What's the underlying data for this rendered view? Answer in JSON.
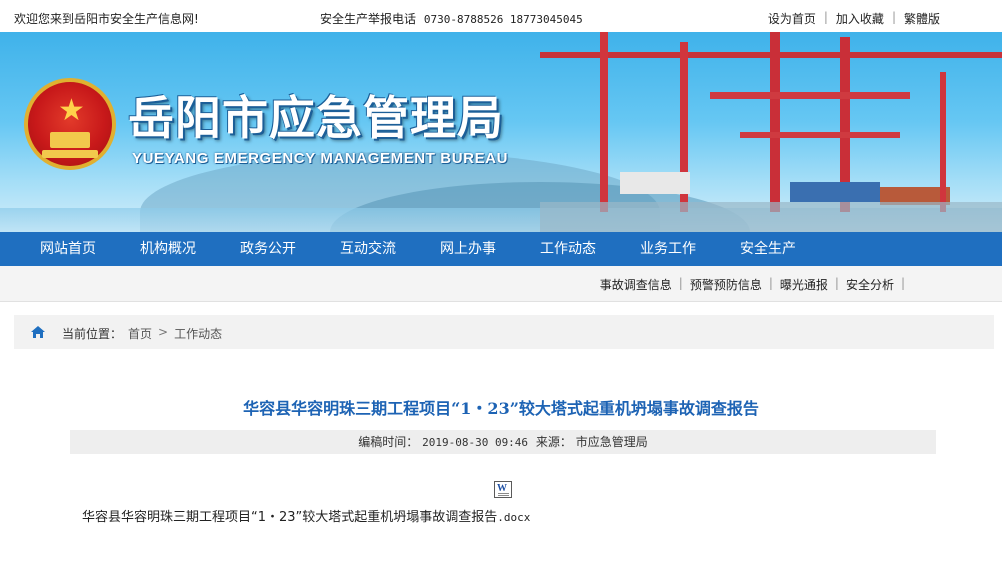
{
  "topbar": {
    "welcome": "欢迎您来到岳阳市安全生产信息网!",
    "hotline_label": "安全生产举报电话",
    "hotline_numbers": "0730-8788526 18773045045",
    "links": [
      "设为首页",
      "加入收藏",
      "繁體版"
    ]
  },
  "header": {
    "site_name": "岳阳市应急管理局",
    "site_name_en": "YUEYANG EMERGENCY MANAGEMENT BUREAU",
    "emblem_icon": "national-emblem-icon"
  },
  "nav": {
    "items": [
      "网站首页",
      "机构概况",
      "政务公开",
      "互动交流",
      "网上办事",
      "工作动态",
      "业务工作",
      "安全生产"
    ]
  },
  "subnav": {
    "items": [
      "事故调查信息",
      "预警预防信息",
      "曝光通报",
      "安全分析"
    ]
  },
  "breadcrumb": {
    "icon": "home-icon",
    "label": "当前位置：",
    "path": [
      "首页",
      "工作动态"
    ]
  },
  "article": {
    "title": "华容县华容明珠三期工程项目“1・23”较大塔式起重机坍塌事故调查报告",
    "meta_time_label": "编稿时间：",
    "meta_time": "2019-08-30 09:46",
    "meta_source_label": "来源：",
    "meta_source": "市应急管理局",
    "attachment_icon": "word-document-icon",
    "attachment_name": "华容县华容明珠三期工程项目“1・23”较大塔式起重机坍塌事故调查报告",
    "attachment_ext": ".docx"
  },
  "colors": {
    "nav_bg": "#1f6fc0",
    "title": "#1d63b4",
    "banner_sky": "#3fb2ea"
  }
}
